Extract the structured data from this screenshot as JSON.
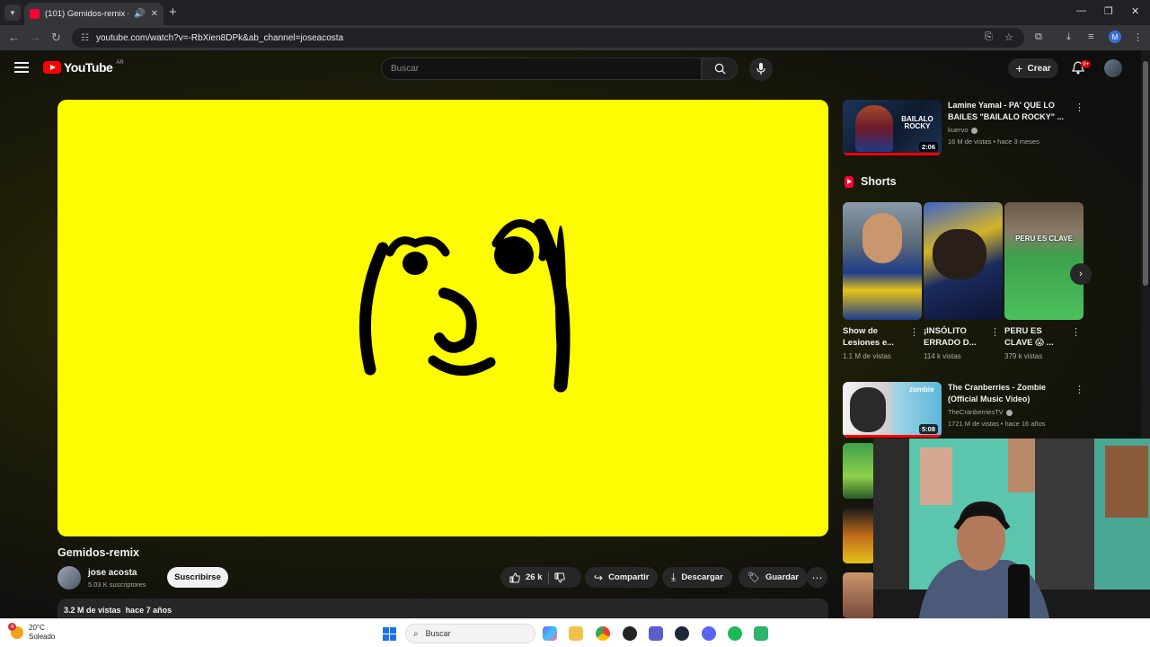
{
  "browser": {
    "tab_title": "(101) Gemidos-remix - YouTube",
    "url": "youtube.com/watch?v=-RbXien8DPk&ab_channel=joseacosta",
    "profile_initial": "M"
  },
  "masthead": {
    "logo_text": "YouTube",
    "country_code": "AR",
    "search_placeholder": "Buscar",
    "create_label": "Crear",
    "notif_badge": "9+"
  },
  "video": {
    "title": "Gemidos-remix",
    "channel_name": "jose acosta",
    "subscribers": "5.03 K suscriptores",
    "subscribe_label": "Suscribirse",
    "likes": "26 k",
    "share_label": "Compartir",
    "download_label": "Descargar",
    "save_label": "Guardar",
    "views": "3.2 M de vistas",
    "age": "hace 7 años",
    "frame_bg": "#fffb00"
  },
  "sidebar": {
    "related": [
      {
        "title": "Lamine Yamal - PA' QUE LO BAILES \"BAILALO ROCKY\" ...",
        "channel": "kuervo",
        "meta": "16 M de vistas • hace 3 meses",
        "duration": "2:06",
        "thumb_text": "BAILALO ROCKY",
        "watched_fraction": 1.0
      },
      {
        "title": "The Cranberries - Zombie (Official Music Video)",
        "channel": "TheCranberriesTV",
        "meta": "1721 M de vistas • hace 16 años",
        "duration": "5:08",
        "thumb_text": "zombie",
        "watched_fraction": 1.0
      }
    ],
    "shorts_heading": "Shorts",
    "shorts": [
      {
        "title": "Show de Lesiones e...",
        "views": "1.1 M de vistas"
      },
      {
        "title": "¡INSÓLITO ERRADO D...",
        "views": "114 k vistas"
      },
      {
        "title": "PERU ES CLAVE 😱 ...",
        "views": "379 k vistas",
        "thumb_text": "PERU ES CLAVE"
      }
    ]
  },
  "taskbar": {
    "temperature": "20°C",
    "weather": "Soleado",
    "weather_badge": "4",
    "search_placeholder": "Buscar"
  }
}
